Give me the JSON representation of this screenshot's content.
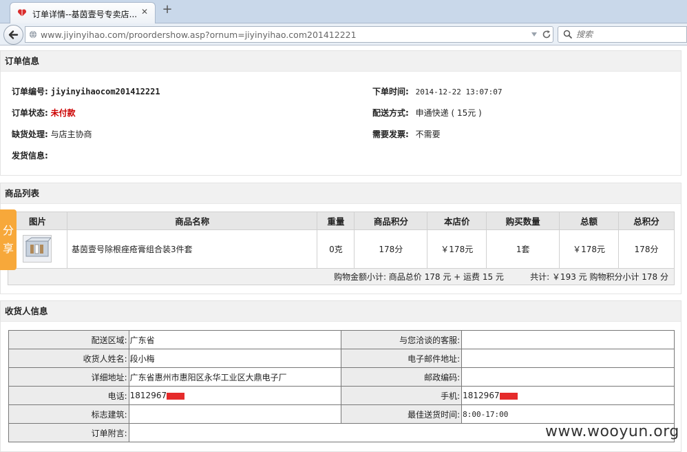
{
  "browser": {
    "tab_title": "订单详情--基茵壹号专卖店...",
    "url": "www.jiyinyihao.com/proordershow.asp?ornum=jiyinyihao.com201412221",
    "search_placeholder": "搜索"
  },
  "order": {
    "section_title": "订单信息",
    "number_label": "订单编号:",
    "number_value": "jiyinyihaocom201412221",
    "status_label": "订单状态:",
    "status_value": "未付款",
    "status_color": "#cc0000",
    "shortage_label": "缺货处理:",
    "shortage_value": "与店主协商",
    "shipping_label": "发货信息:",
    "time_label": "下单时间:",
    "time_value": "2014-12-22 13:07:07",
    "delivery_label": "配送方式:",
    "delivery_value": "申通快递 ( 15元 )",
    "invoice_label": "需要发票:",
    "invoice_value": "不需要"
  },
  "products": {
    "section_title": "商品列表",
    "headers": [
      "图片",
      "商品名称",
      "重量",
      "商品积分",
      "本店价",
      "购买数量",
      "总额",
      "总积分"
    ],
    "row": {
      "image": "product-thumbnail",
      "name": "基茵壹号除根痤疮膏组合装3件套",
      "weight": "0克",
      "points": "178分",
      "price": "￥178元",
      "qty": "1套",
      "total": "￥178元",
      "total_points": "178分"
    },
    "summary": "购物金额小计: 商品总价 178 元 + 运费 15 元          共计: ￥193 元 购物积分小计 178 分"
  },
  "share": {
    "label_1": "分",
    "label_2": "享"
  },
  "receiver": {
    "section_title": "收货人信息",
    "rows": [
      {
        "k1": "配送区域:",
        "v1": "广东省",
        "k2": "与您洽谈的客服:",
        "v2": ""
      },
      {
        "k1": "收货人姓名:",
        "v1": "段小梅",
        "k2": "电子邮件地址:",
        "v2": ""
      },
      {
        "k1": "详细地址:",
        "v1": "广东省惠州市惠阳区永华工业区大鼎电子厂",
        "k2": "邮政编码:",
        "v2": ""
      },
      {
        "k1": "电话:",
        "v1": "1812967",
        "k2": "手机:",
        "v2": "1812967"
      },
      {
        "k1": "标志建筑:",
        "v1": "",
        "k2": "最佳送货时间:",
        "v2": "8:00-17:00"
      },
      {
        "k1": "订单附言:",
        "v1": ""
      }
    ]
  },
  "watermark": "www.wooyun.org"
}
